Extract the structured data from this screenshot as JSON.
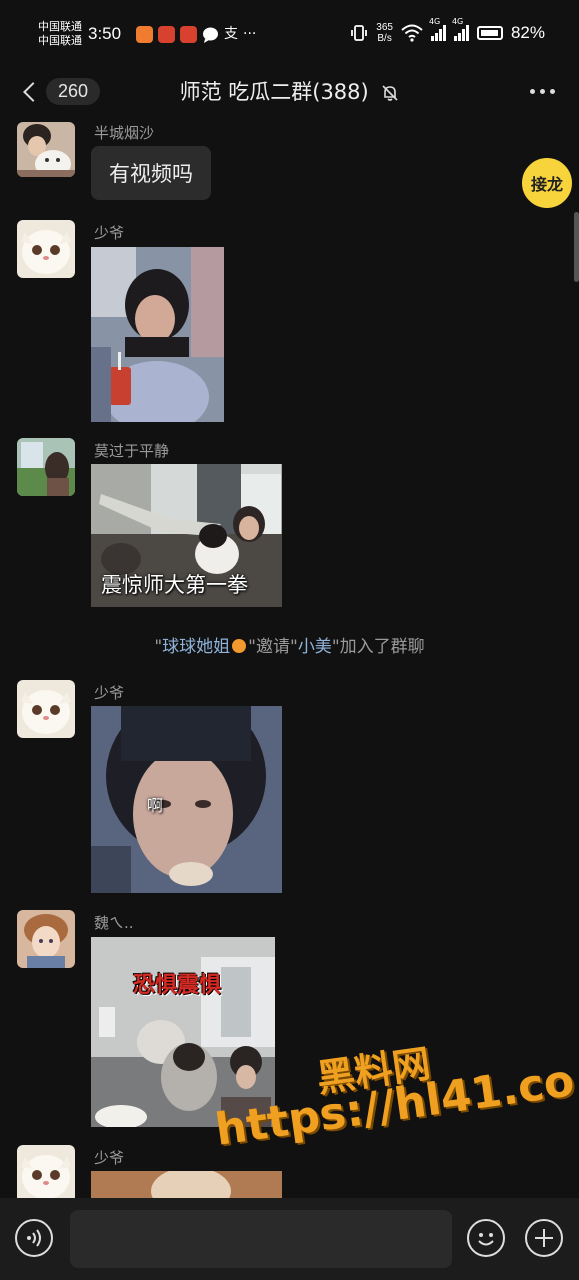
{
  "status_bar": {
    "carrier_1": "中国联通",
    "carrier_2": "中国联通",
    "time": "3:50",
    "speed_value": "365",
    "speed_unit": "B/s",
    "net_1": "4G",
    "net_2": "4G",
    "battery": "82%",
    "icons": [
      "app-icon",
      "app-icon",
      "app-icon",
      "message-icon",
      "alipay-icon",
      "more-dots"
    ]
  },
  "header": {
    "back_count": "260",
    "title": "师范 吃瓜二群(388)",
    "mute_icon": "bell-off-icon",
    "more_icon": "more-icon"
  },
  "jielong": "接龙",
  "messages": [
    {
      "sender": "半城烟沙",
      "type": "text",
      "text": "有视频吗"
    },
    {
      "sender": "少爷",
      "type": "image"
    },
    {
      "sender": "莫过于平静",
      "type": "image",
      "caption": "震惊师大第一拳"
    },
    {
      "type": "system",
      "parts": [
        "\"",
        "球球她姐",
        "\"邀请\"",
        "小美",
        "\"加入了群聊"
      ]
    },
    {
      "sender": "少爷",
      "type": "image",
      "caption": "啊"
    },
    {
      "sender": "魏ㄟ..",
      "type": "image",
      "caption": "恐惧震惧"
    },
    {
      "sender": "少爷",
      "type": "image"
    }
  ],
  "watermark": {
    "line1": "黑料网",
    "line2": "https://hl41.co"
  },
  "input_bar": {
    "placeholder": "",
    "voice_icon": "voice-icon",
    "emoji_icon": "emoji-icon",
    "plus_icon": "plus-icon"
  }
}
